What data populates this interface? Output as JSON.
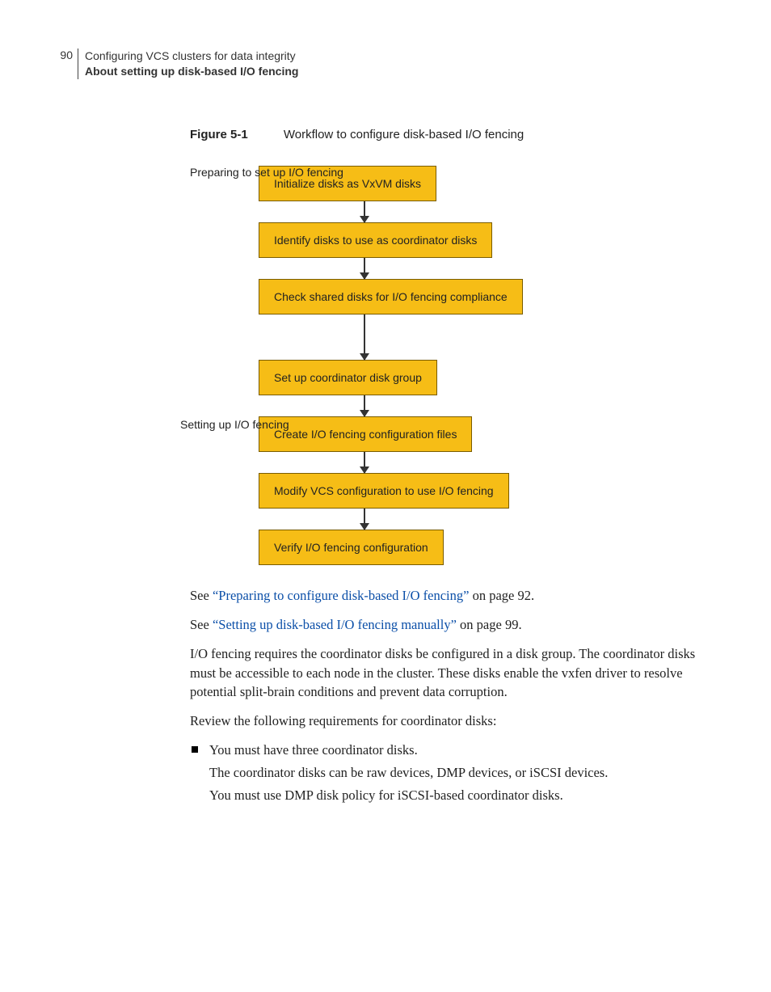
{
  "header": {
    "page_number": "90",
    "chapter": "Configuring VCS clusters for data integrity",
    "section": "About setting up disk-based I/O fencing"
  },
  "figure": {
    "number": "Figure 5-1",
    "title": "Workflow to configure disk-based I/O fencing"
  },
  "workflow": {
    "group_prep_label": "Preparing to set up I/O fencing",
    "group_setup_label": "Setting up I/O fencing",
    "steps": [
      "Initialize disks as VxVM disks",
      "Identify disks to use as coordinator disks",
      "Check shared disks for I/O fencing compliance",
      "Set up coordinator disk group",
      "Create I/O fencing configuration files",
      "Modify VCS configuration to use I/O fencing",
      "Verify I/O fencing configuration"
    ]
  },
  "body": {
    "see1_pre": "See ",
    "see1_link": "“Preparing to configure disk-based I/O fencing”",
    "see1_post": " on page 92.",
    "see2_pre": "See ",
    "see2_link": "“Setting up disk-based I/O fencing manually”",
    "see2_post": " on page 99.",
    "para1": "I/O fencing requires the coordinator disks be configured in a disk group. The coordinator disks must be accessible to each node in the cluster. These disks enable the vxfen driver to resolve potential split-brain conditions and prevent data corruption.",
    "para2": "Review the following requirements for coordinator disks:",
    "bullet1_line1": "You must have three coordinator disks.",
    "bullet1_line2": "The coordinator disks can be raw devices, DMP devices, or iSCSI devices.",
    "bullet1_line3": "You must use DMP disk policy for iSCSI-based coordinator disks."
  },
  "chart_data": {
    "type": "flowchart",
    "title": "Workflow to configure disk-based I/O fencing",
    "groups": [
      {
        "label": "Preparing to set up I/O fencing",
        "steps": [
          "Initialize disks as VxVM disks",
          "Identify disks to use as coordinator disks",
          "Check shared disks for I/O fencing compliance"
        ]
      },
      {
        "label": "Setting up I/O fencing",
        "steps": [
          "Set up coordinator disk group",
          "Create I/O fencing configuration files",
          "Modify VCS configuration to use I/O fencing",
          "Verify I/O fencing configuration"
        ]
      }
    ],
    "edges": "sequential top-to-bottom arrows between every consecutive step",
    "box_fill": "#f6bd16",
    "box_border": "#7a5c00"
  }
}
